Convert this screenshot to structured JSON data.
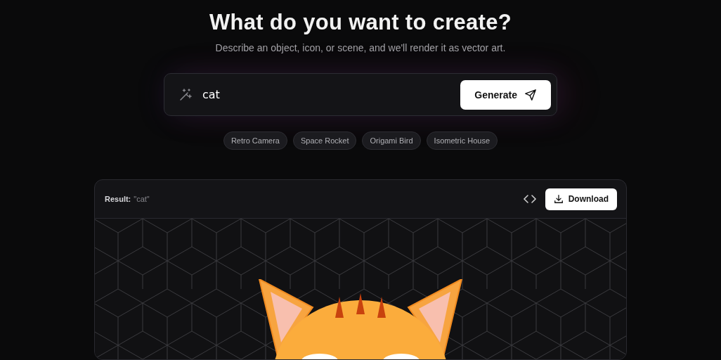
{
  "heading": "What do you want to create?",
  "subheading": "Describe an object, icon, or scene, and we'll render it as vector art.",
  "prompt": {
    "value": "cat",
    "button": "Generate"
  },
  "suggestions": [
    "Retro Camera",
    "Space Rocket",
    "Origami Bird",
    "Isometric House"
  ],
  "result": {
    "label": "Result:",
    "query": "\"cat\"",
    "download": "Download"
  }
}
